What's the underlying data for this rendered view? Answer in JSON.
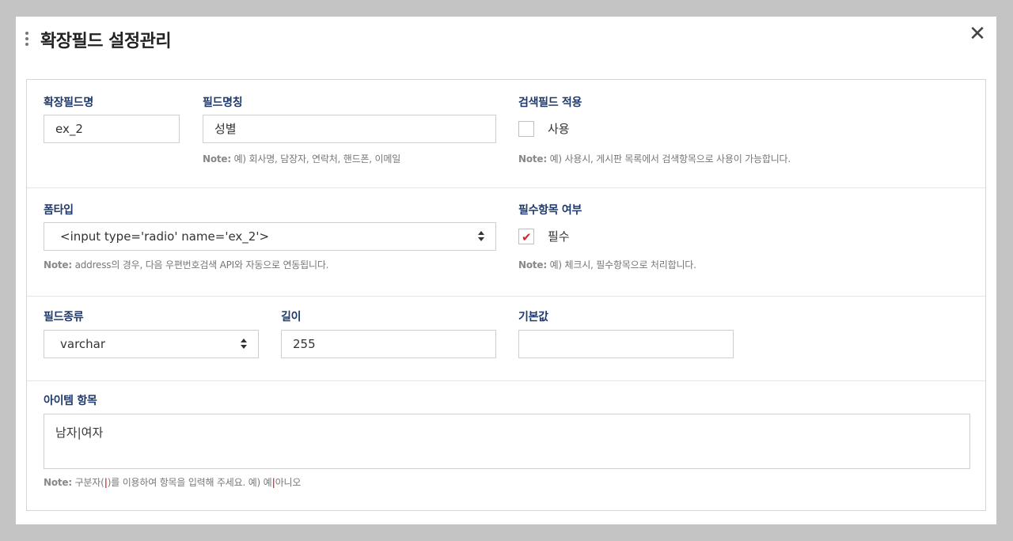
{
  "dialog": {
    "title": "확장필드 설정관리",
    "close_label": "✕"
  },
  "extension_field_name": {
    "label": "확장필드명",
    "value": "ex_2"
  },
  "field_display_name": {
    "label": "필드명칭",
    "value": "성별",
    "note_prefix": "Note:",
    "note_text": " 예) 회사명, 담장자, 연락처, 핸드폰, 이메일"
  },
  "search_field": {
    "label": "검색필드 적용",
    "checkbox_label": "사용",
    "checked": false,
    "note_prefix": "Note:",
    "note_text": " 예) 사용시, 게시판 목록에서 검색항목으로 사용이 가능합니다."
  },
  "form_type": {
    "label": "폼타입",
    "selected": "<input type='radio' name='ex_2'>",
    "note_prefix": "Note:",
    "note_text": " address의 경우, 다음 우편번호검색 API와 자동으로 연동됩니다."
  },
  "required": {
    "label": "필수항목 여부",
    "checkbox_label": "필수",
    "checked": true,
    "check_glyph": "✔",
    "note_prefix": "Note:",
    "note_text": " 예) 체크시, 필수항목으로 처리합니다."
  },
  "field_type": {
    "label": "필드종류",
    "selected": "varchar"
  },
  "length": {
    "label": "길이",
    "value": "255"
  },
  "default_value": {
    "label": "기본값",
    "value": ""
  },
  "items": {
    "label": "아이템 항목",
    "value": "남자|여자",
    "note_prefix": "Note:",
    "note_part1": " 구분자(",
    "note_sep": "|",
    "note_part2": ")를 이용하여 항목을 입력해 주세요. 예) 예",
    "note_sep2": "|",
    "note_part3": "아니오"
  },
  "colors": {
    "label_color": "#1f3a6b",
    "check_color": "#d2262b",
    "backdrop": "#c4c4c4"
  }
}
